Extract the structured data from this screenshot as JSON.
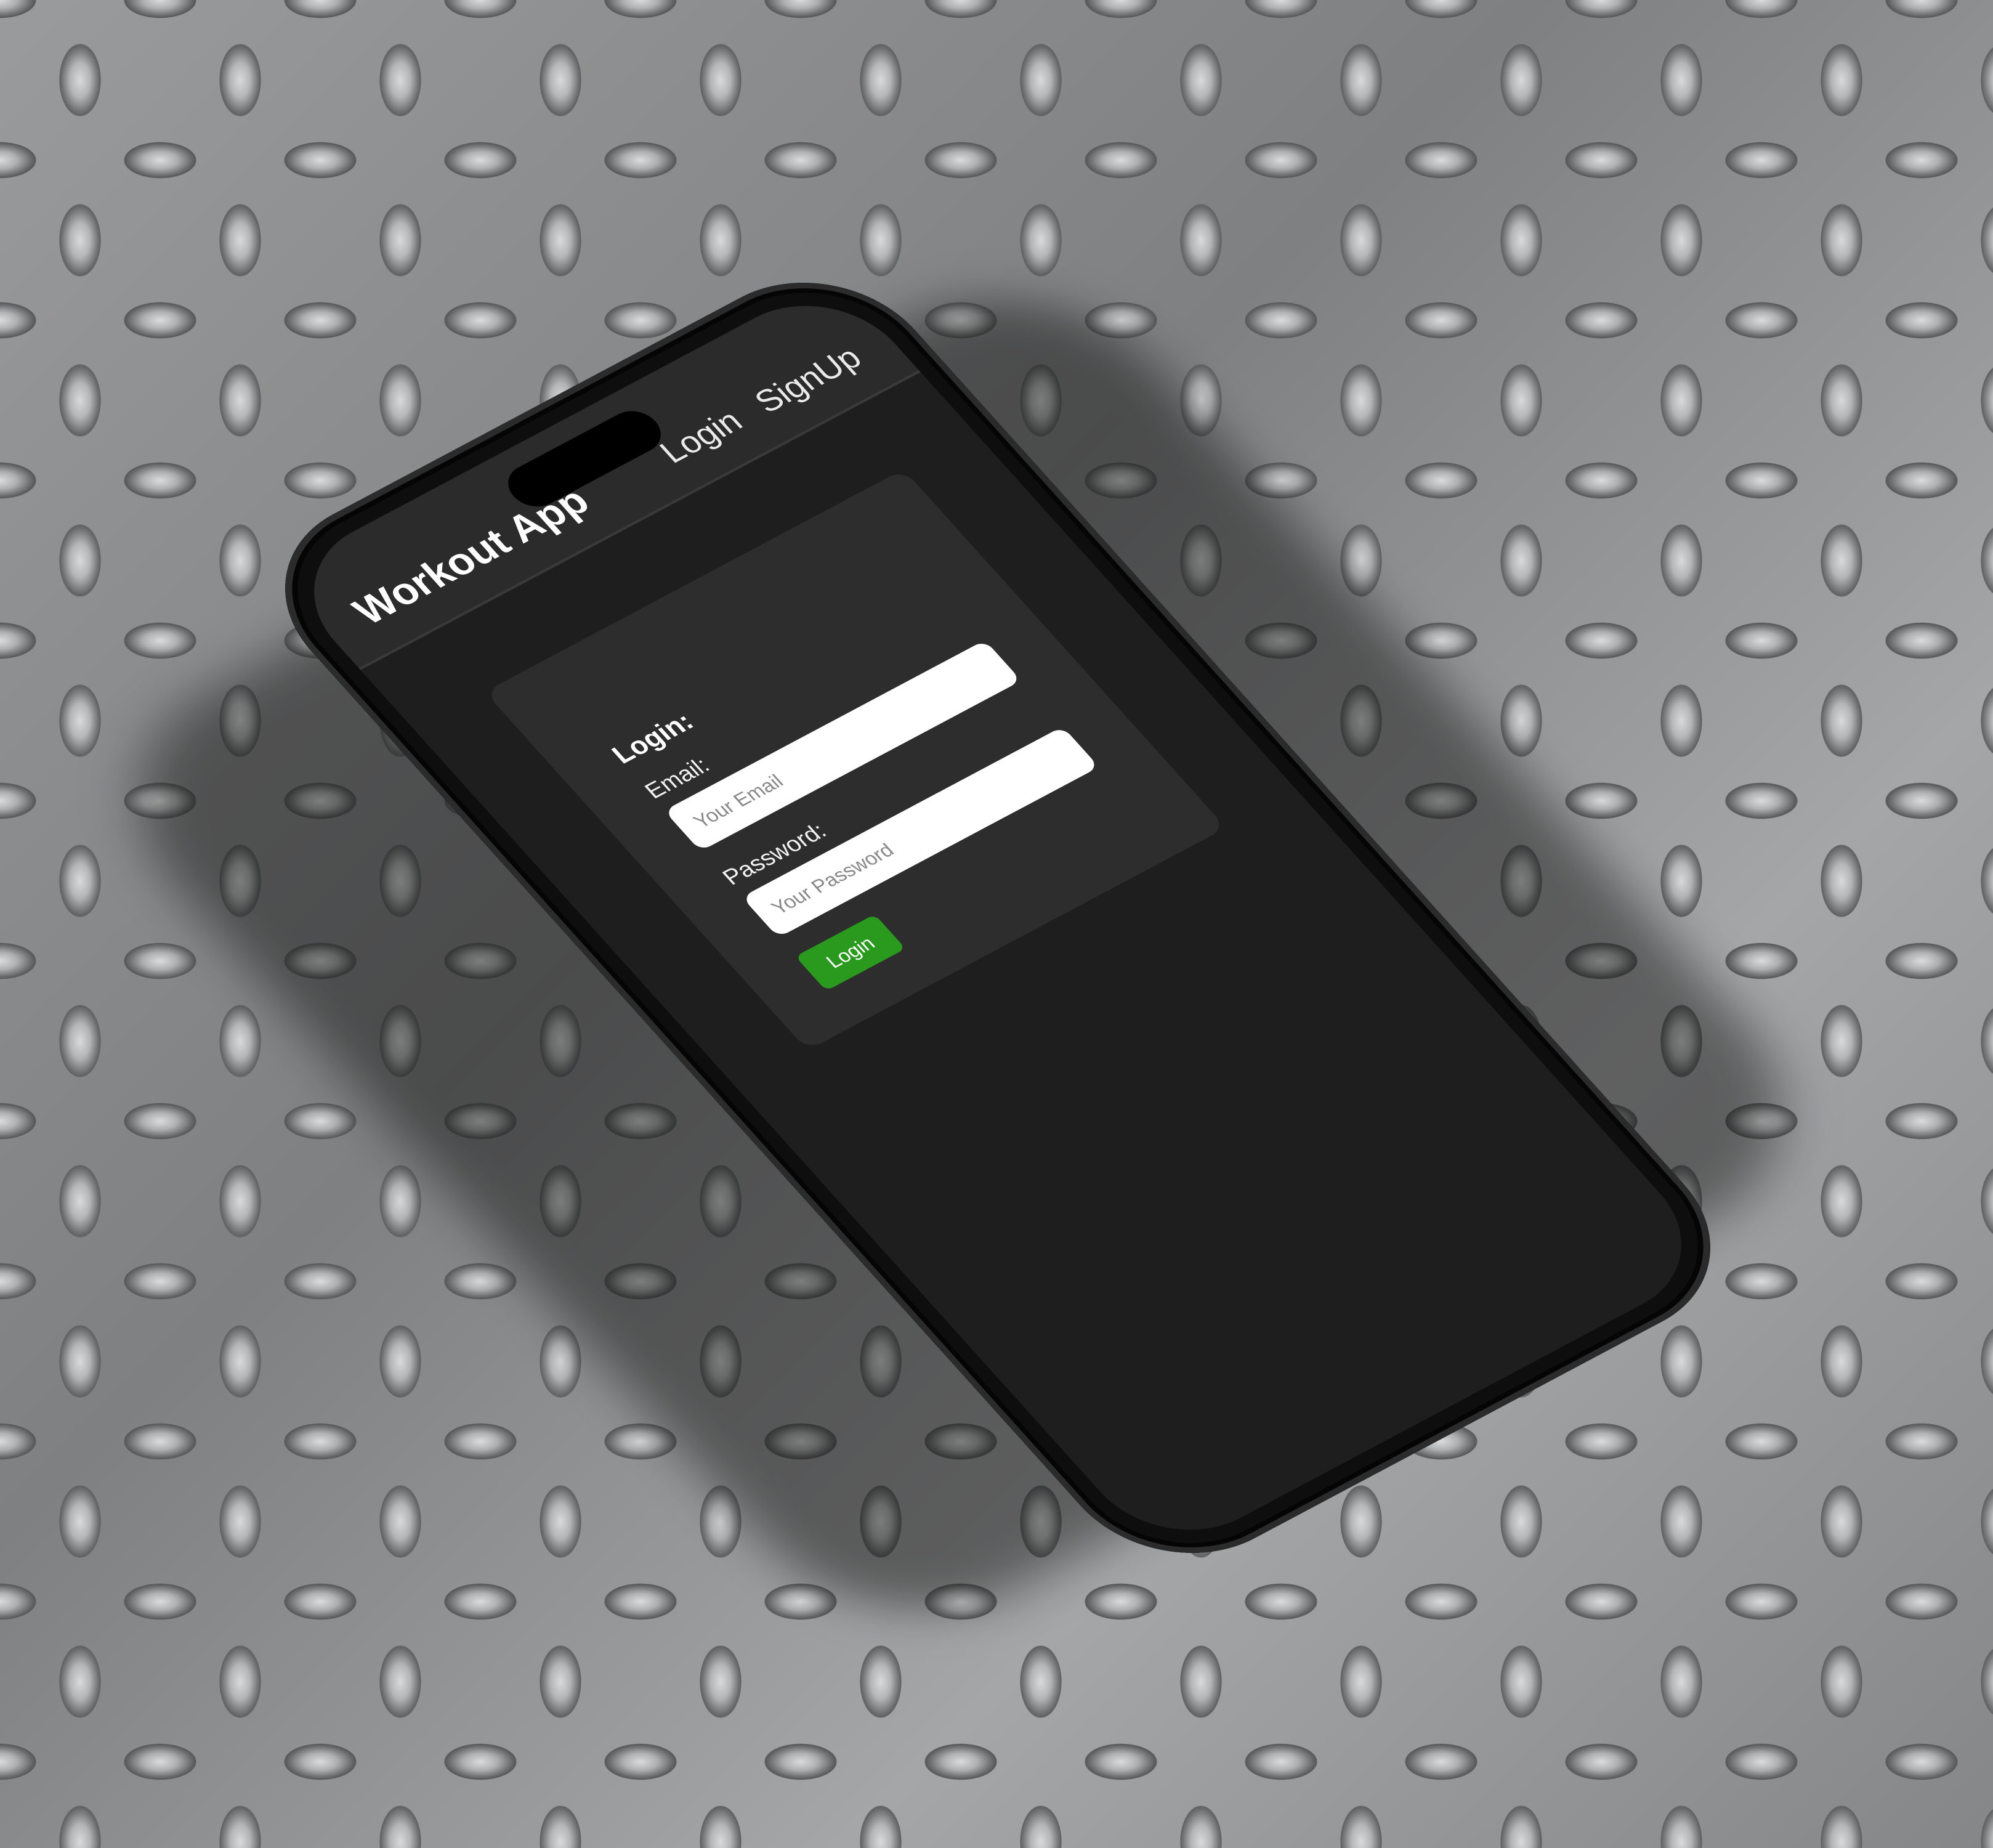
{
  "navbar": {
    "brand": "Workout App",
    "links": [
      "Login",
      "SignUp"
    ]
  },
  "login_form": {
    "title": "Login:",
    "email_label": "Email:",
    "email_placeholder": "Your Email",
    "password_label": "Password:",
    "password_placeholder": "Your Password",
    "submit_label": "Login"
  },
  "colors": {
    "navbar_bg": "#2b2b2b",
    "screen_bg": "#1e1e1e",
    "card_bg": "#2d2d2d",
    "button_green": "#2a9a1e"
  }
}
